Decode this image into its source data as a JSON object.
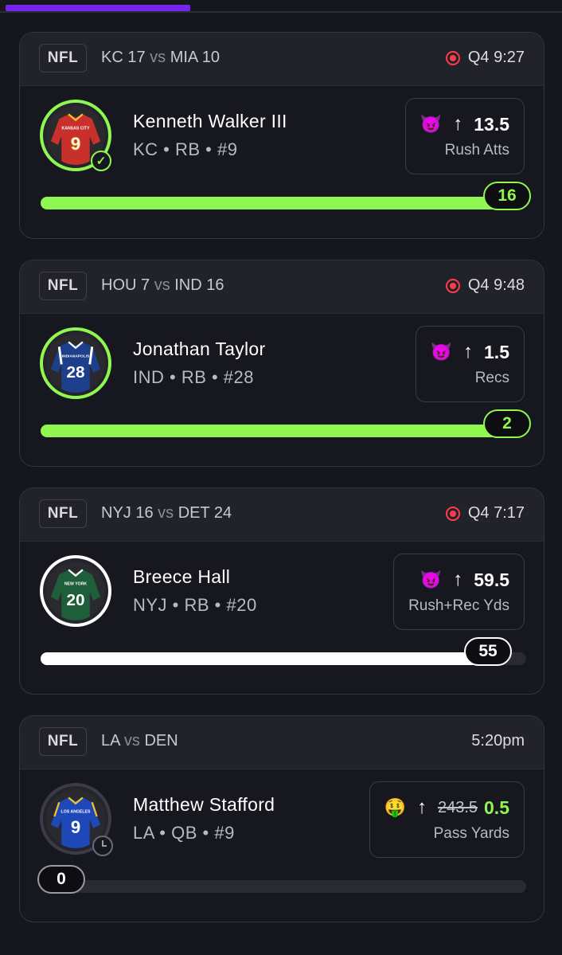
{
  "top_progress": {
    "fraction": 0.33
  },
  "cards": [
    {
      "league": "NFL",
      "team_a": "KC 17",
      "vs": "vs",
      "team_b": "MIA 10",
      "status": "Q4 9:27",
      "live": true,
      "player_name": "Kenneth Walker III",
      "player_meta": "KC • RB • #9",
      "jersey": {
        "city": "KANSAS CITY",
        "number": "9",
        "color": "#c8302c",
        "trim": "#f2c230"
      },
      "prop_emoji": "😈",
      "prop_line": "13.5",
      "prop_stat": "Rush Atts",
      "progress_value": "16",
      "progress_fraction": 1.0,
      "hit": true
    },
    {
      "league": "NFL",
      "team_a": "HOU 7",
      "vs": "vs",
      "team_b": "IND 16",
      "status": "Q4 9:48",
      "live": true,
      "player_name": "Jonathan Taylor",
      "player_meta": "IND • RB • #28",
      "jersey": {
        "city": "INDIANAPOLIS",
        "number": "28",
        "color": "#1d3f8c",
        "trim": "#ffffff"
      },
      "prop_emoji": "😈",
      "prop_line": "1.5",
      "prop_stat": "Recs",
      "progress_value": "2",
      "progress_fraction": 1.0,
      "hit": true
    },
    {
      "league": "NFL",
      "team_a": "NYJ 16",
      "vs": "vs",
      "team_b": "DET 24",
      "status": "Q4 7:17",
      "live": true,
      "player_name": "Breece Hall",
      "player_meta": "NYJ • RB • #20",
      "jersey": {
        "city": "NEW YORK",
        "number": "20",
        "color": "#1f5e3a",
        "trim": "#ffffff"
      },
      "prop_emoji": "😈",
      "prop_line": "59.5",
      "prop_stat": "Rush+Rec Yds",
      "progress_value": "55",
      "progress_fraction": 0.92,
      "hit": false
    },
    {
      "league": "NFL",
      "team_a": "LA",
      "vs": "vs",
      "team_b": "DEN",
      "status": "5:20pm",
      "live": false,
      "player_name": "Matthew Stafford",
      "player_meta": "LA • QB • #9",
      "jersey": {
        "city": "LOS ANGELES",
        "number": "9",
        "color": "#1e48b8",
        "trim": "#f2c230"
      },
      "prop_emoji": "🤑",
      "prop_line_old": "243.5",
      "prop_line": "0.5",
      "prop_stat": "Pass Yards",
      "progress_value": "0",
      "progress_fraction": 0.0,
      "hit": false
    }
  ]
}
